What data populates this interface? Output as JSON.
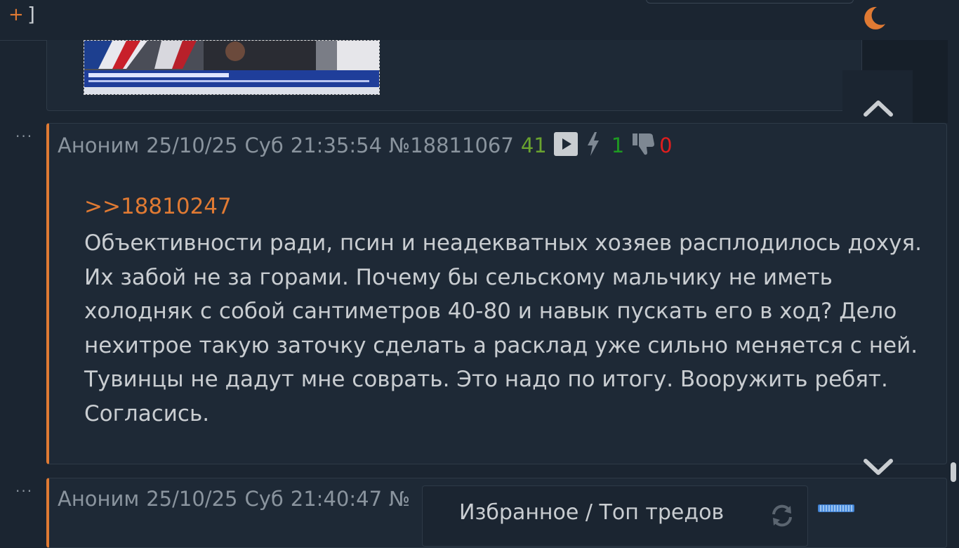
{
  "topbar": {
    "plus_label": "+",
    "bracket_label": "]",
    "moon_icon": "moon-icon",
    "accent_color": "#e07a33"
  },
  "prev_post": {
    "image_alt": "thumbnail"
  },
  "post": {
    "dots": "···",
    "author": "Аноним",
    "date": "25/10/25",
    "weekday": "Суб",
    "time": "21:35:54",
    "number": "№18811067",
    "score": "41",
    "likes": "1",
    "dislikes": "0",
    "reply_link": ">>18810247",
    "body": "Объективности ради, псин и неадекватных хозяев расплодилось дохуя. Их забой не за горами. Почему бы сельскому мальчику не иметь холодняк с собой сантиметров 40-80 и навык пускать его в ход? Дело нехитрое такую заточку сделать а расклад уже сильно меняется с ней. Тувинцы не дадут мне соврать. Это надо по итогу. Вооружить ребят. Согласись."
  },
  "next_post": {
    "dots": "···",
    "author": "Аноним",
    "date": "25/10/25",
    "weekday": "Суб",
    "time": "21:40:47",
    "number_prefix": "№"
  },
  "favorites": {
    "label": "Избранное / Топ тредов"
  },
  "icons": {
    "up": "chevron-up-icon",
    "down": "chevron-down-icon",
    "refresh": "refresh-icon",
    "play": "play-icon",
    "bolt": "bolt-icon",
    "thumbs_down": "thumbs-down-icon"
  },
  "colors": {
    "background": "#1b2531",
    "post_bg": "#1e2936",
    "score": "#6aa32f",
    "likes": "#1e9a22",
    "dislikes": "#e01e1e",
    "meta": "#8a949e"
  }
}
